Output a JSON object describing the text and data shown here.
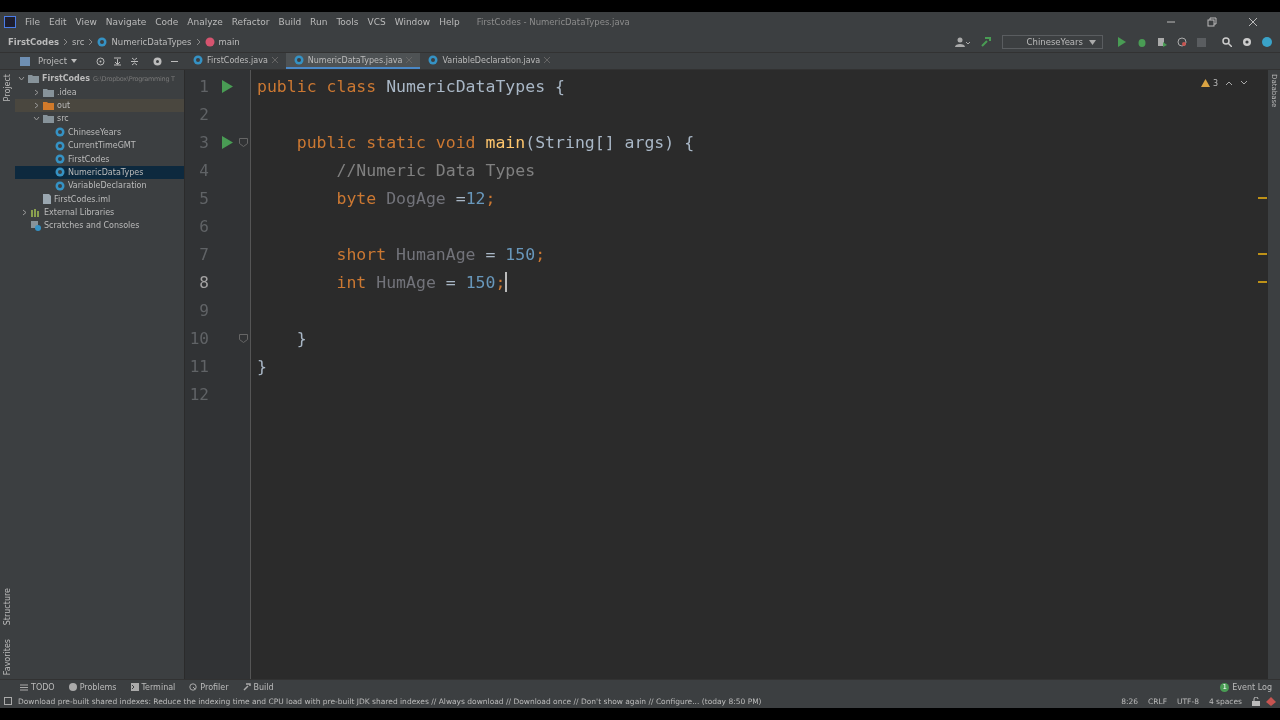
{
  "window": {
    "title": "FirstCodes - NumericDataTypes.java"
  },
  "menu": [
    "File",
    "Edit",
    "View",
    "Navigate",
    "Code",
    "Analyze",
    "Refactor",
    "Build",
    "Run",
    "Tools",
    "VCS",
    "Window",
    "Help"
  ],
  "breadcrumbs": [
    {
      "kind": "project",
      "label": "FirstCodes"
    },
    {
      "kind": "folder",
      "label": "src"
    },
    {
      "kind": "class",
      "label": "NumericDataTypes"
    },
    {
      "kind": "method",
      "label": "main"
    }
  ],
  "run_config": "ChineseYears",
  "project_panel": {
    "title": "Project",
    "tree": [
      {
        "label": "FirstCodes",
        "hint": "G:\\Dropbox\\Programming T",
        "kind": "module",
        "expanded": true,
        "selected": false,
        "children": [
          {
            "label": ".idea",
            "kind": "folder",
            "expanded": false,
            "selected": false
          },
          {
            "label": "out",
            "kind": "excluded",
            "expanded": false,
            "selected": false
          },
          {
            "label": "src",
            "kind": "folder",
            "expanded": true,
            "selected": false,
            "children": [
              {
                "label": "ChineseYears",
                "kind": "class",
                "selected": false
              },
              {
                "label": "CurrentTimeGMT",
                "kind": "class",
                "selected": false
              },
              {
                "label": "FirstCodes",
                "kind": "class",
                "selected": false
              },
              {
                "label": "NumericDataTypes",
                "kind": "class",
                "selected": true
              },
              {
                "label": "VariableDeclaration",
                "kind": "class",
                "selected": false
              }
            ]
          },
          {
            "label": "FirstCodes.iml",
            "kind": "file",
            "selected": false
          }
        ]
      },
      {
        "label": "External Libraries",
        "kind": "library",
        "expanded": false,
        "selected": false
      },
      {
        "label": "Scratches and Consoles",
        "kind": "scratch",
        "selected": false
      }
    ]
  },
  "tabs": [
    {
      "label": "FirstCodes.java",
      "selected": false
    },
    {
      "label": "NumericDataTypes.java",
      "selected": true
    },
    {
      "label": "VariableDeclaration.java",
      "selected": false
    }
  ],
  "warnings": "3",
  "code": [
    {
      "number": "1",
      "run": true,
      "fold": false,
      "current": false,
      "warning": false,
      "tokens": [
        {
          "kind": "keyword",
          "text": "public class "
        },
        {
          "kind": "plain",
          "text": "NumericDataTypes {"
        }
      ]
    },
    {
      "number": "2",
      "run": false,
      "fold": false,
      "current": false,
      "warning": false
    },
    {
      "number": "3",
      "run": true,
      "fold": true,
      "current": false,
      "warning": false,
      "tokens": [
        {
          "kind": "keyword",
          "text": "    public static void "
        },
        {
          "kind": "method",
          "text": "main"
        },
        {
          "kind": "plain",
          "text": "(String[] args) {"
        }
      ]
    },
    {
      "number": "4",
      "run": false,
      "fold": false,
      "current": false,
      "warning": false,
      "tokens": [
        {
          "kind": "comment",
          "text": "        //Numeric Data Types"
        }
      ]
    },
    {
      "number": "5",
      "run": false,
      "fold": false,
      "current": false,
      "warning": true,
      "tokens": [
        {
          "kind": "keyword",
          "text": "        byte "
        },
        {
          "kind": "unused",
          "text": "DogAge "
        },
        {
          "kind": "plain",
          "text": "="
        },
        {
          "kind": "number",
          "text": "12"
        },
        {
          "kind": "keyword",
          "text": ";"
        }
      ]
    },
    {
      "number": "6",
      "run": false,
      "fold": false,
      "current": false,
      "warning": false
    },
    {
      "number": "7",
      "run": false,
      "fold": false,
      "current": false,
      "warning": true,
      "tokens": [
        {
          "kind": "keyword",
          "text": "        short "
        },
        {
          "kind": "unused",
          "text": "HumanAge "
        },
        {
          "kind": "plain",
          "text": "= "
        },
        {
          "kind": "number",
          "text": "150"
        },
        {
          "kind": "keyword",
          "text": ";"
        }
      ]
    },
    {
      "number": "8",
      "run": false,
      "fold": false,
      "current": true,
      "warning": true,
      "tokens": [
        {
          "kind": "keyword",
          "text": "        int "
        },
        {
          "kind": "unused",
          "text": "HumAge "
        },
        {
          "kind": "plain",
          "text": "= "
        },
        {
          "kind": "number",
          "text": "150"
        },
        {
          "kind": "keyword",
          "text": ";"
        }
      ]
    },
    {
      "number": "9",
      "run": false,
      "fold": false,
      "current": false,
      "warning": false
    },
    {
      "number": "10",
      "run": false,
      "fold": true,
      "current": false,
      "warning": false,
      "tokens": [
        {
          "kind": "plain",
          "text": "    }"
        }
      ]
    },
    {
      "number": "11",
      "run": false,
      "fold": false,
      "current": false,
      "warning": false,
      "tokens": [
        {
          "kind": "plain",
          "text": "}"
        }
      ]
    },
    {
      "number": "12",
      "run": false,
      "fold": false,
      "current": false,
      "warning": false
    }
  ],
  "side_labels": {
    "left_top": "Project",
    "left_bottom": [
      "Structure",
      "Favorites"
    ],
    "right": "Database"
  },
  "tool_windows": [
    {
      "kind": "list",
      "label": "TODO"
    },
    {
      "kind": "problems",
      "label": "Problems"
    },
    {
      "kind": "terminal",
      "label": "Terminal"
    },
    {
      "kind": "profiler",
      "label": "Profiler"
    },
    {
      "kind": "build",
      "label": "Build"
    }
  ],
  "event_log": {
    "label": "Event Log",
    "count": "1"
  },
  "status_bar": {
    "message": "Download pre-built shared indexes: Reduce the indexing time and CPU load with pre-built JDK shared indexes // Always download // Download once // Don't show again // Configure... (today 8:50 PM)",
    "items": [
      "8:26",
      "CRLF",
      "UTF-8",
      "4 spaces"
    ]
  }
}
